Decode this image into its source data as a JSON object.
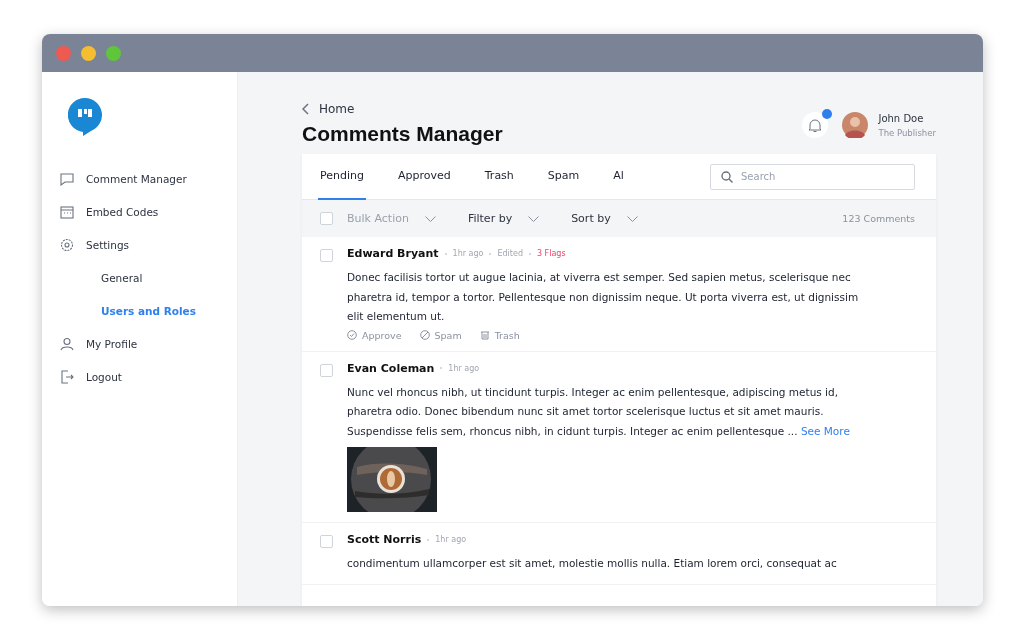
{
  "sidebar": {
    "items": [
      {
        "label": "Comment Manager",
        "selected": false
      },
      {
        "label": "Embed Codes",
        "selected": false
      },
      {
        "label": "Settings",
        "selected": false,
        "children": [
          {
            "label": "General",
            "selected": false
          },
          {
            "label": "Users and Roles",
            "selected": true
          }
        ]
      },
      {
        "label": "My Profile",
        "selected": false
      },
      {
        "label": "Logout",
        "selected": false
      }
    ]
  },
  "breadcrumb": "Home",
  "title": "Comments Manager",
  "notifications": {
    "unread": true
  },
  "user": {
    "name": "John Doe",
    "role": "The Publisher"
  },
  "tabs": [
    {
      "label": "Pending",
      "selected": true
    },
    {
      "label": "Approved",
      "selected": false
    },
    {
      "label": "Trash",
      "selected": false
    },
    {
      "label": "Spam",
      "selected": false
    },
    {
      "label": "Al",
      "selected": false
    }
  ],
  "search": {
    "placeholder": "Search"
  },
  "toolbar": {
    "select_all": {
      "checked": false
    },
    "dropdowns": [
      {
        "label": "Bulk Action",
        "disabled": true
      },
      {
        "label": "Filter by",
        "disabled": false
      },
      {
        "label": "Sort by",
        "disabled": false
      }
    ],
    "count": "123 Comments"
  },
  "comments": [
    {
      "checked": false,
      "author": "Edward Bryant",
      "time": "1hr ago",
      "tags": [
        {
          "text": "Edited",
          "kind": "muted"
        },
        {
          "text": "3 Flags",
          "kind": "alert"
        }
      ],
      "text": "Donec facilisis tortor ut augue lacinia, at viverra est semper. Sed sapien metus, scelerisque nec pharetra id, tempor a tortor. Pellentesque non dignissim neque. Ut porta viverra est, ut dignissim elit elementum ut.",
      "actions": [
        "Approve",
        "Spam",
        "Trash"
      ]
    },
    {
      "checked": false,
      "author": "Evan Coleman",
      "time": "1hr ago",
      "text": " Nunc vel rhoncus nibh, ut tincidunt turpis. Integer ac enim pellentesque, adipiscing metus id, pharetra odio. Donec bibendum nunc sit amet tortor scelerisque luctus et sit amet mauris. Suspendisse felis sem, rhoncus nibh,  in cidunt turpis. Integer ac enim pellentesque ...",
      "link": "See More"
    },
    {
      "checked": false,
      "author": "Scott Norris",
      "time": "1hr ago",
      "text": "condimentum ullamcorper est sit amet, molestie mollis nulla. Etiam lorem orci, consequat ac"
    }
  ]
}
